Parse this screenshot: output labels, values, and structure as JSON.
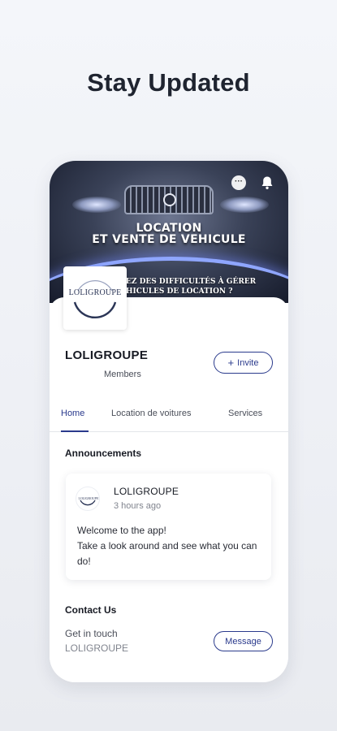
{
  "promo": {
    "headline": "Stay Updated"
  },
  "cover": {
    "tagline_line1": "LOCATION",
    "tagline_line2": "ET VENTE DE VEHICULE",
    "sub_line1": "EZ DES DIFFICULTÉS À GÉRER",
    "sub_line2": "HICULES DE LOCATION ?"
  },
  "group": {
    "logo_text": "LOLIGROUPE",
    "name": "LOLIGROUPE",
    "members_label": "Members",
    "invite_icon": "+",
    "invite_label": "Invite"
  },
  "tabs": [
    {
      "label": "Home",
      "active": true
    },
    {
      "label": "Location de voitures",
      "active": false
    },
    {
      "label": "Services",
      "active": false
    }
  ],
  "announcements": {
    "title": "Announcements",
    "card": {
      "avatar_text": "LOLIGROUPE",
      "author": "LOLIGROUPE",
      "time": "3 hours ago",
      "body": "Welcome to the app!\nTake a look around and see what you can do!"
    }
  },
  "contact": {
    "title": "Contact Us",
    "line1": "Get in touch",
    "line2": "LOLIGROUPE",
    "message_label": "Message"
  },
  "icons": {
    "more": "more-icon",
    "bell": "bell-icon",
    "plus": "plus-icon"
  },
  "colors": {
    "accent": "#2a3a8c",
    "background": "#f1f3f7"
  }
}
